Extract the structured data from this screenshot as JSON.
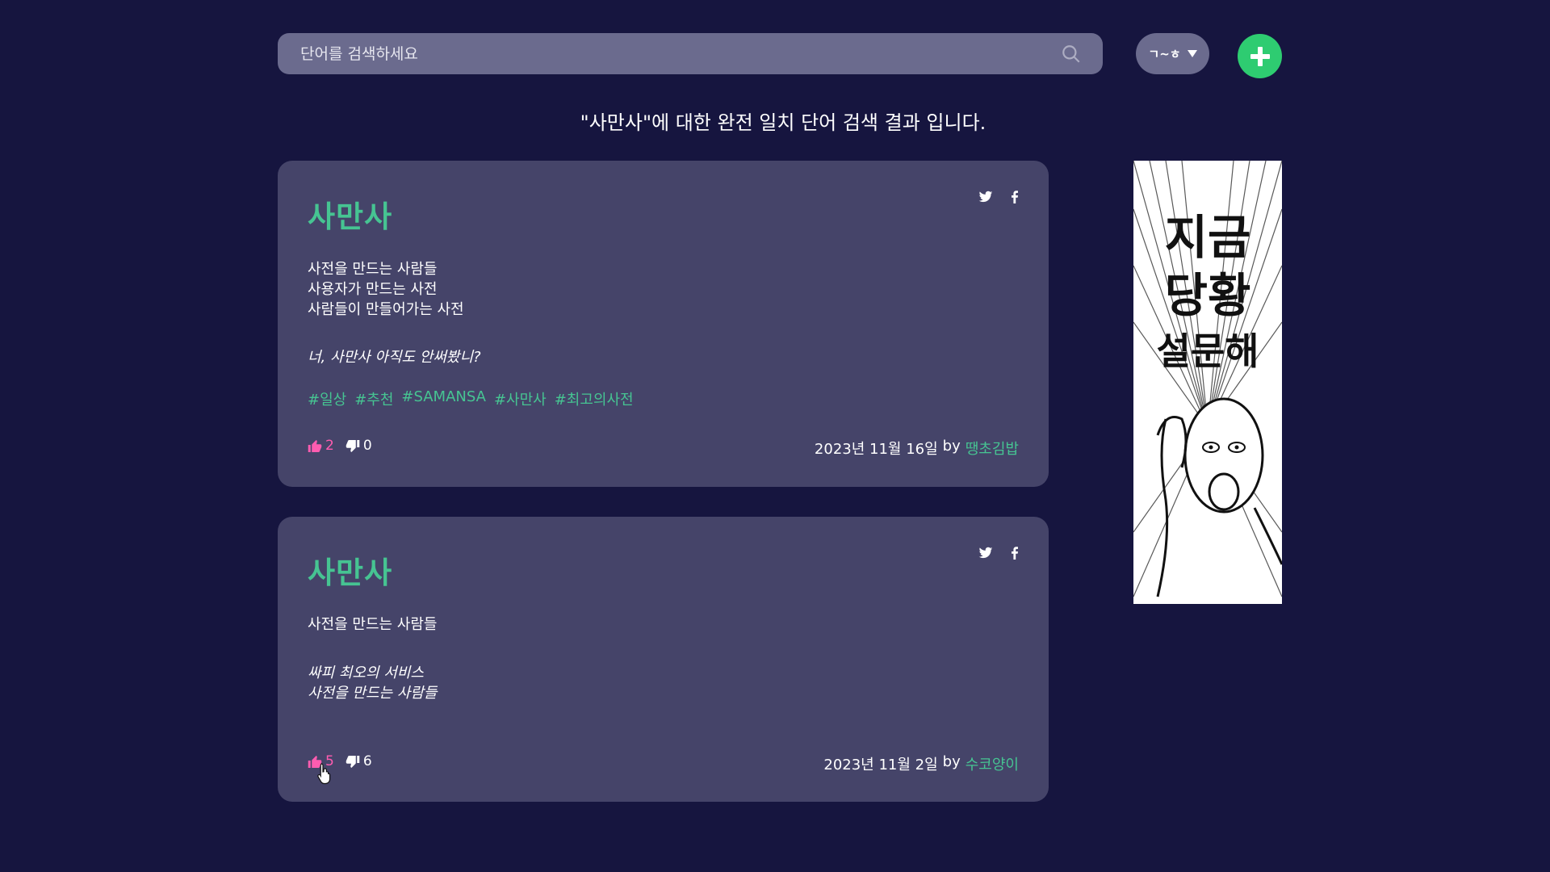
{
  "search": {
    "placeholder": "단어를 검색하세요",
    "value": ""
  },
  "sort": {
    "selected": "ㄱ~ㅎ"
  },
  "add_button": {
    "icon": "plus-icon",
    "color": "#2ecc71"
  },
  "result_title": "\"사만사\"에 대한 완전 일치 단어 검색 결과 입니다.",
  "cards": [
    {
      "word": "사만사",
      "definition": [
        "사전을 만드는 사람들",
        "사용자가 만드는 사전",
        "사람들이 만들어가는 사전"
      ],
      "example": [
        "너, 사만사 아직도 안써봤니?"
      ],
      "tags": [
        "#일상",
        "#추천",
        "#SAMANSA",
        "#사만사",
        "#최고의사전"
      ],
      "likes": "2",
      "dislikes": "0",
      "date": "2023년 11월 16일",
      "by": "by",
      "author": "땡초김밥"
    },
    {
      "word": "사만사",
      "definition": [
        "사전을 만드는 사람들"
      ],
      "example": [
        "싸피 최오의 서비스",
        "사전을 만드는 사람들"
      ],
      "tags": [],
      "likes": "5",
      "dislikes": "6",
      "date": "2023년 11월 2일",
      "by": "by",
      "author": "수코양이"
    }
  ],
  "ad": {
    "line1": "지금",
    "line2": "당황",
    "line3": "설문해"
  },
  "colors": {
    "background": "#16153f",
    "card": "#454469",
    "accent": "#46c492",
    "like": "#ff5cb0",
    "input": "#6b6b8e"
  }
}
